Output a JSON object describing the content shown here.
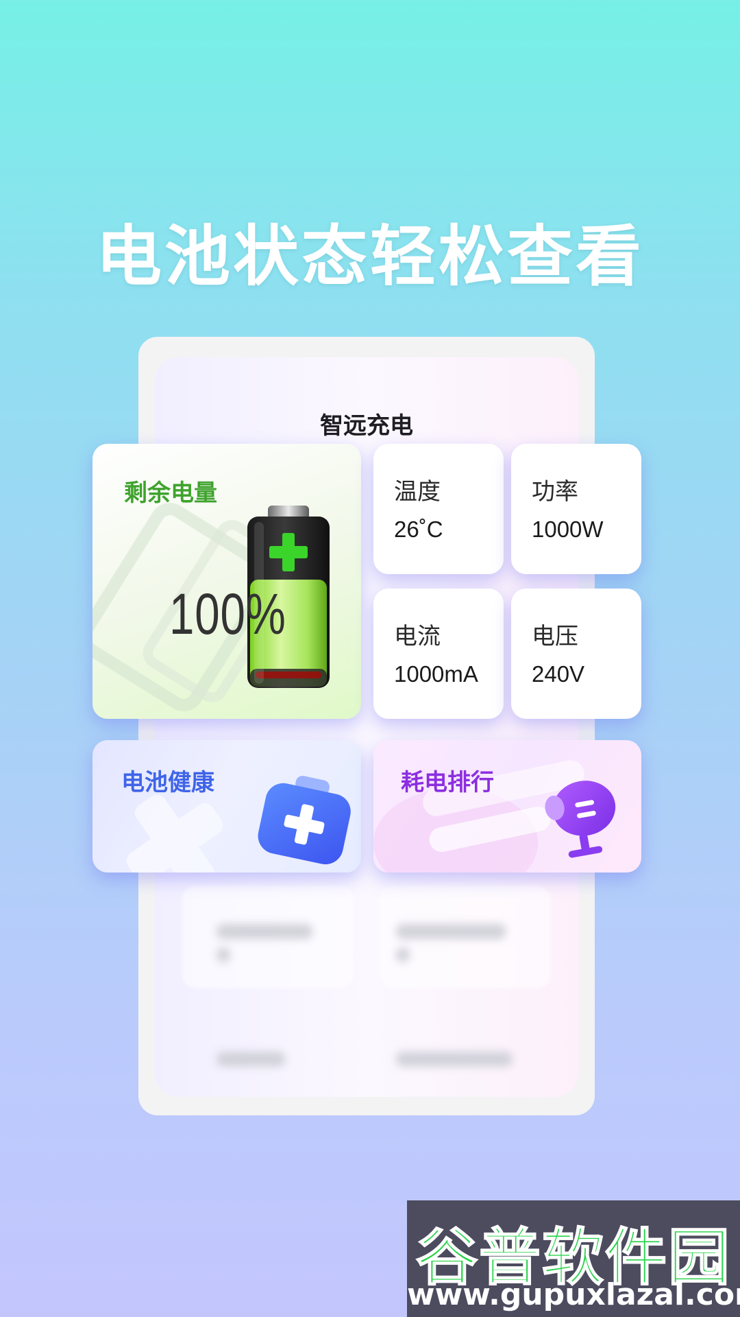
{
  "headline": "电池状态轻松查看",
  "phone": {
    "title": "智远充电"
  },
  "remaining": {
    "label": "剩余电量",
    "value": "100%"
  },
  "metrics": {
    "temperature": {
      "label": "温度",
      "value": "26˚C"
    },
    "power": {
      "label": "功率",
      "value": "1000W"
    },
    "current": {
      "label": "电流",
      "value": "1000mA"
    },
    "voltage": {
      "label": "电压",
      "value": "240V"
    }
  },
  "features": {
    "health": {
      "label": "电池健康",
      "icon": "medical-kit-icon"
    },
    "ranking": {
      "label": "耗电排行",
      "icon": "plug-icon"
    }
  },
  "watermark": {
    "title": "谷普软件园",
    "url": "www.gupuxlazal.com"
  },
  "colors": {
    "remaining_label": "#3fa32e",
    "health_label": "#3f64e8",
    "ranking_label": "#8c2ee0",
    "battery_fill": "#8fe33a"
  }
}
